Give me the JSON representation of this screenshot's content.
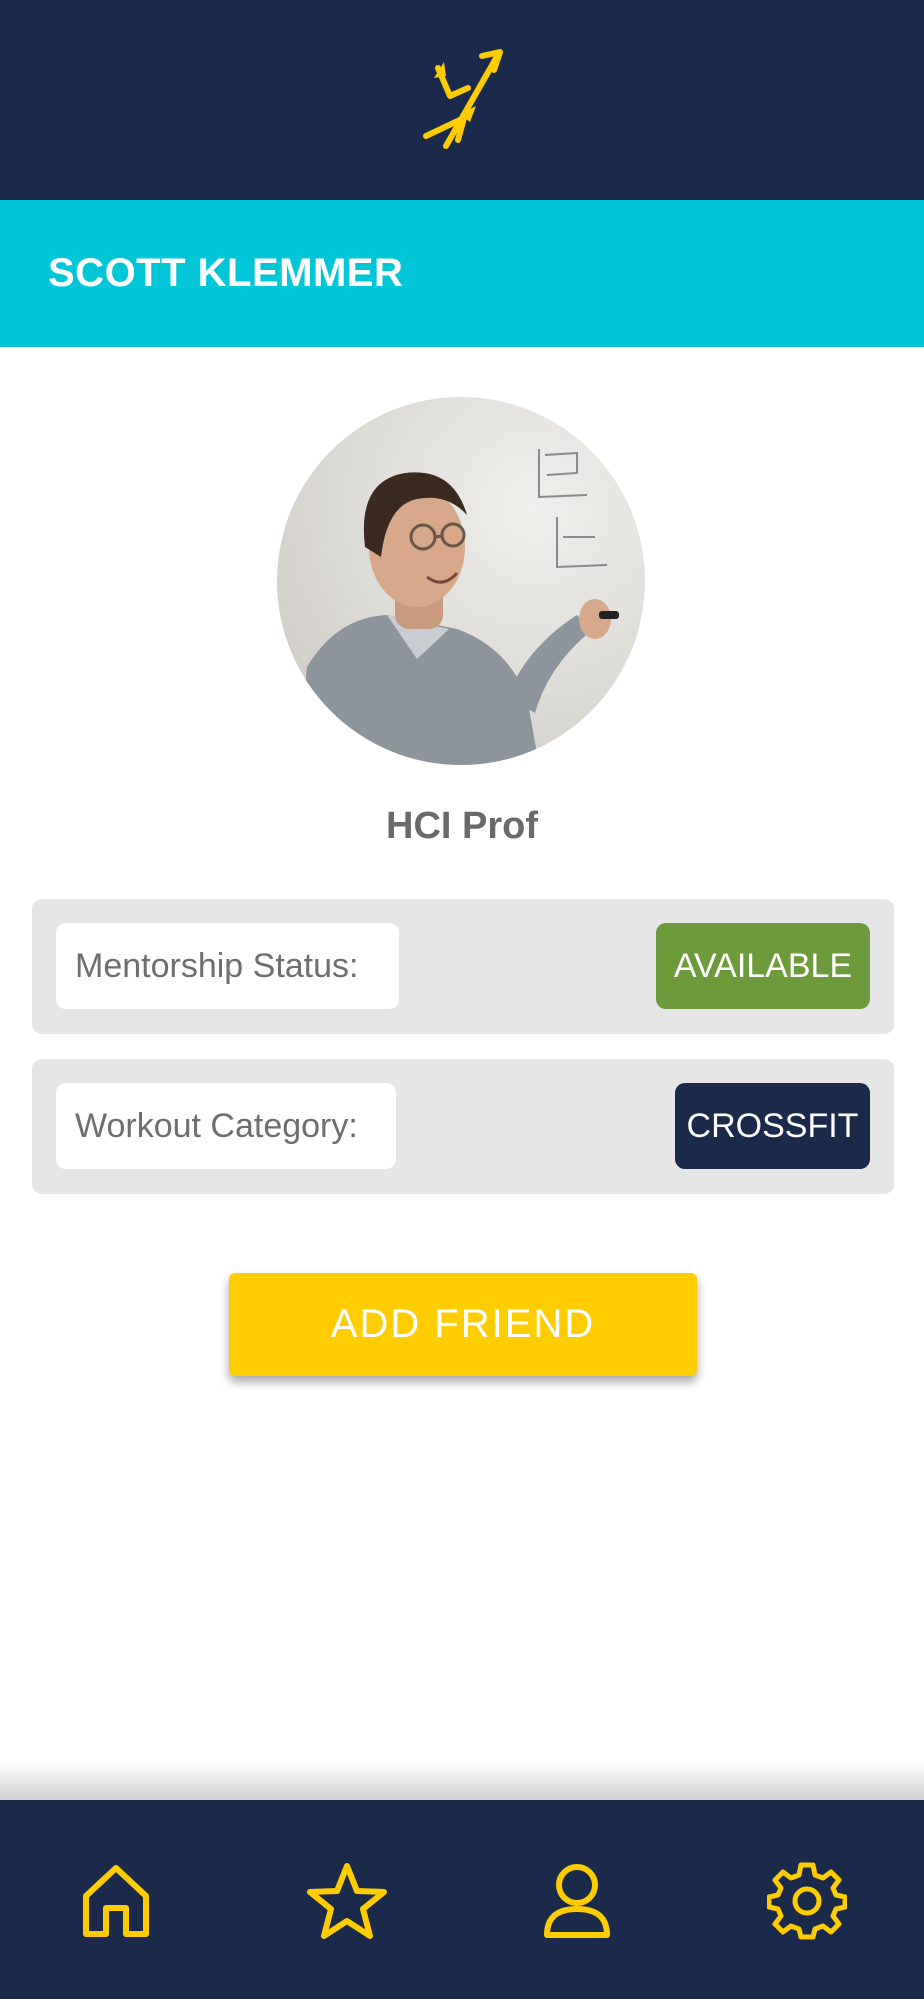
{
  "app": {
    "logo_icon": "trident-icon",
    "accent_color": "#ffcc00",
    "header_color": "#1b2a4a",
    "namebar_color": "#00c6d7"
  },
  "profile": {
    "name": "SCOTT KLEMMER",
    "title": "HCI Prof",
    "avatar": "profile-photo"
  },
  "info_cards": [
    {
      "label": "Mentorship Status:",
      "value": "AVAILABLE",
      "badge_color": "#6d9a3a"
    },
    {
      "label": "Workout Category:",
      "value": "CROSSFIT",
      "badge_color": "#1b2a4a"
    }
  ],
  "actions": {
    "add_friend_label": "ADD FRIEND"
  },
  "bottom_nav": [
    {
      "icon": "home-icon"
    },
    {
      "icon": "star-icon"
    },
    {
      "icon": "user-icon"
    },
    {
      "icon": "gear-icon"
    }
  ]
}
